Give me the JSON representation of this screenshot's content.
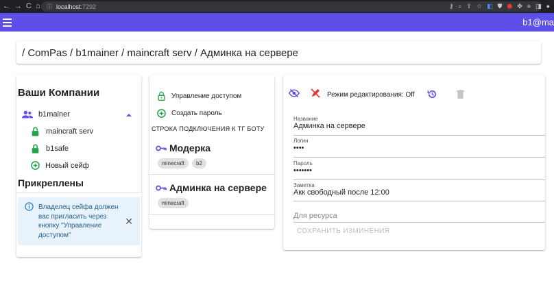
{
  "browser": {
    "url_host": "localhost",
    "url_port": ":7292",
    "nav_back": "←",
    "nav_forward": "→",
    "nav_reload": "C",
    "nav_home": "⌂"
  },
  "appbar": {
    "user": "b1@ma",
    "color": "#5e4fe8"
  },
  "breadcrumb": "/ ComPas / b1mainer / maincraft serv / Админка на сервере",
  "sidebar": {
    "title": "Ваши Компании",
    "company": "b1mainer",
    "items": [
      {
        "label": "maincraft serv",
        "icon": "lock-icon"
      },
      {
        "label": "b1safe",
        "icon": "lock-icon"
      },
      {
        "label": "Новый сейф",
        "icon": "add-circle-icon"
      }
    ],
    "pinned_title": "Прикреплены",
    "alert_text": "Владелец сейфа должен вас пригласить через кнопку \"Управление доступом\""
  },
  "middle": {
    "access_label": "Управление доступом",
    "create_label": "Создать пароль",
    "tg_label": "СТРОКА ПОДКЛЮЧЕНИЯ К ТГ БОТУ",
    "passwords": [
      {
        "title": "Модерка",
        "tags": [
          "minecraft",
          "b2"
        ]
      },
      {
        "title": "Админка на сервере",
        "tags": [
          "minecraft"
        ]
      }
    ]
  },
  "detail": {
    "edit_mode": "Режим редактирования: Off",
    "fields": [
      {
        "label": "Название",
        "value": "Админка на сервере"
      },
      {
        "label": "Логин",
        "value": "••••"
      },
      {
        "label": "Пароль",
        "value": "•••••••"
      },
      {
        "label": "Заметка",
        "value": "Акк свободный после 12:00"
      }
    ],
    "resource_placeholder": "Для ресурса",
    "save_label": "СОХРАНИТЬ ИЗМИНЕНИЯ"
  }
}
